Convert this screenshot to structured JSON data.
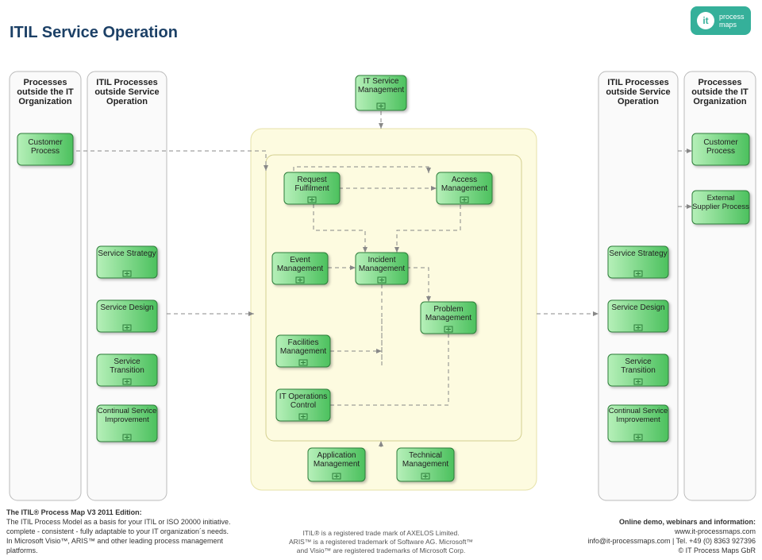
{
  "title": "ITIL Service Operation",
  "logo": {
    "mark": "it",
    "line1": "process",
    "line2": "maps"
  },
  "lanes": {
    "left_outside_org": "Processes outside the IT Organization",
    "left_outside_svc": "ITIL Processes outside Service Operation",
    "right_outside_svc": "ITIL Processes outside Service Operation",
    "right_outside_org": "Processes outside the IT Organization"
  },
  "boxes": {
    "it_service_mgmt": "IT Service Management",
    "customer_process_l": "Customer Process",
    "customer_process_r": "Customer Process",
    "ext_supplier": "External Supplier Process",
    "service_strategy_l": "Service Strategy",
    "service_design_l": "Service Design",
    "service_transition_l": "Service Transition",
    "csi_l": "Continual Service Improvement",
    "service_strategy_r": "Service Strategy",
    "service_design_r": "Service Design",
    "service_transition_r": "Service Transition",
    "csi_r": "Continual Service Improvement",
    "request_fulfilment": "Request Fulfilment",
    "access_mgmt": "Access Management",
    "event_mgmt": "Event Management",
    "incident_mgmt": "Incident Management",
    "problem_mgmt": "Problem Management",
    "facilities_mgmt": "Facilities Management",
    "it_ops_control": "IT Operations Control",
    "application_mgmt": "Application Management",
    "technical_mgmt": "Technical Management"
  },
  "footer_left": {
    "hdr": "The ITIL® Process Map V3 2011 Edition:",
    "l1": "The ITIL Process Model as a basis for your ITIL or ISO 20000 initiative.",
    "l2": "complete - consistent - fully adaptable to your IT organization´s needs.",
    "l3": "In Microsoft Visio™, ARIS™ and other leading process management platforms."
  },
  "footer_mid": {
    "l1": "ITIL® is a registered trade mark of AXELOS Limited.",
    "l2": "ARIS™ is a  registered trademark of Software AG. Microsoft™",
    "l3": "and Visio™ are registered trademarks of Microsoft Corp."
  },
  "footer_right": {
    "hdr": "Online demo, webinars and information:",
    "l1": "www.it-processmaps.com",
    "l2": "info@it-processmaps.com | Tel. +49 (0) 8363 927396",
    "l3": "© IT Process Maps GbR"
  }
}
